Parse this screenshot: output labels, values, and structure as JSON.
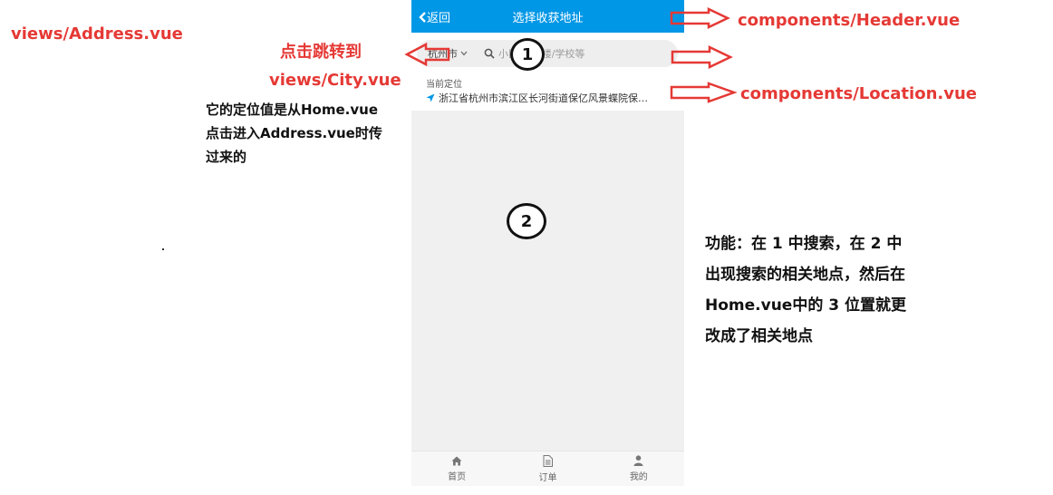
{
  "annotations": {
    "views_address": "views/Address.vue",
    "click_jump": "点击跳转到",
    "views_city": "views/City.vue",
    "location_note": [
      "它的定位值是从Home.vue",
      "点击进入Address.vue时传",
      "过来的"
    ],
    "header_component": "components/Header.vue",
    "location_component": "components/Location.vue",
    "feature_note": [
      "功能：在 1 中搜索，在 2 中",
      "出现搜索的相关地点，然后在",
      "Home.vue中的 3 位置就更",
      "改成了相关地点"
    ],
    "circle_1": "1",
    "circle_2": "2",
    "arrow_color": "#e53935"
  },
  "phone": {
    "header": {
      "back_label": "返回",
      "title": "选择收获地址",
      "bg_color": "#0097e6"
    },
    "search": {
      "city": "杭州市",
      "placeholder": "小区/写字楼/学校等"
    },
    "location": {
      "label": "当前定位",
      "address": "浙江省杭州市滨江区长河街道保亿风景蝶院保…"
    },
    "tabs": [
      {
        "label": "首页",
        "icon": "home-icon"
      },
      {
        "label": "订单",
        "icon": "order-icon"
      },
      {
        "label": "我的",
        "icon": "user-icon"
      }
    ]
  }
}
